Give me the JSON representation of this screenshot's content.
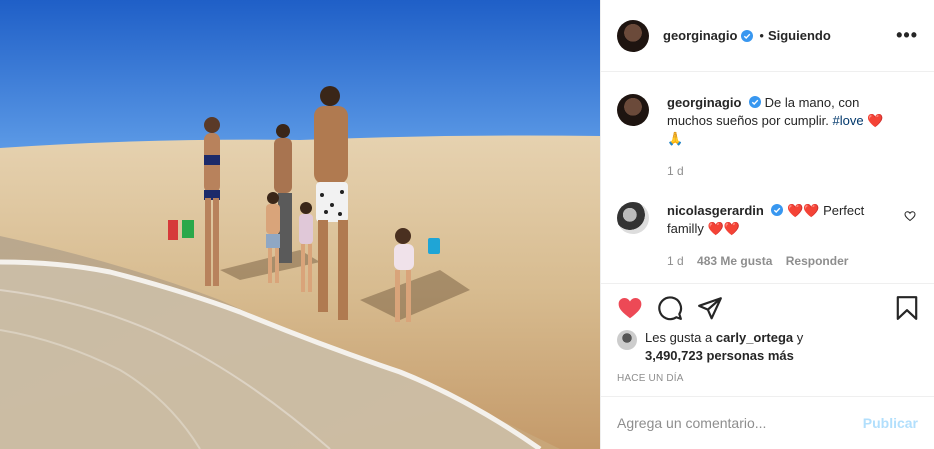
{
  "header": {
    "username": "georginagio",
    "separator": "•",
    "follow_label": "Siguiendo",
    "more_label": "•••"
  },
  "caption": {
    "username": "georginagio",
    "text_line": "De la mano, con muchos sueños por cumplir.",
    "hashtag": "#love",
    "emoji_heart": "❤️",
    "emoji_pray": "🙏",
    "time": "1 d"
  },
  "comment": {
    "username": "nicolasgerardin",
    "hearts_before": "❤️❤️",
    "text": "Perfect familly",
    "hearts_after": "❤️❤️",
    "time": "1 d",
    "likes": "483 Me gusta",
    "reply_label": "Responder"
  },
  "likes": {
    "prefix": "Les gusta a",
    "user": "carly_ortega",
    "conjunction": "y",
    "others": "3,490,723 personas más"
  },
  "time_ago": "HACE UN DÍA",
  "add_comment": {
    "placeholder": "Agrega un comentario...",
    "publish_label": "Publicar"
  },
  "colors": {
    "like_red": "#ed4956",
    "verified_blue": "#3897f0",
    "publish_disabled": "#b2dffc"
  }
}
